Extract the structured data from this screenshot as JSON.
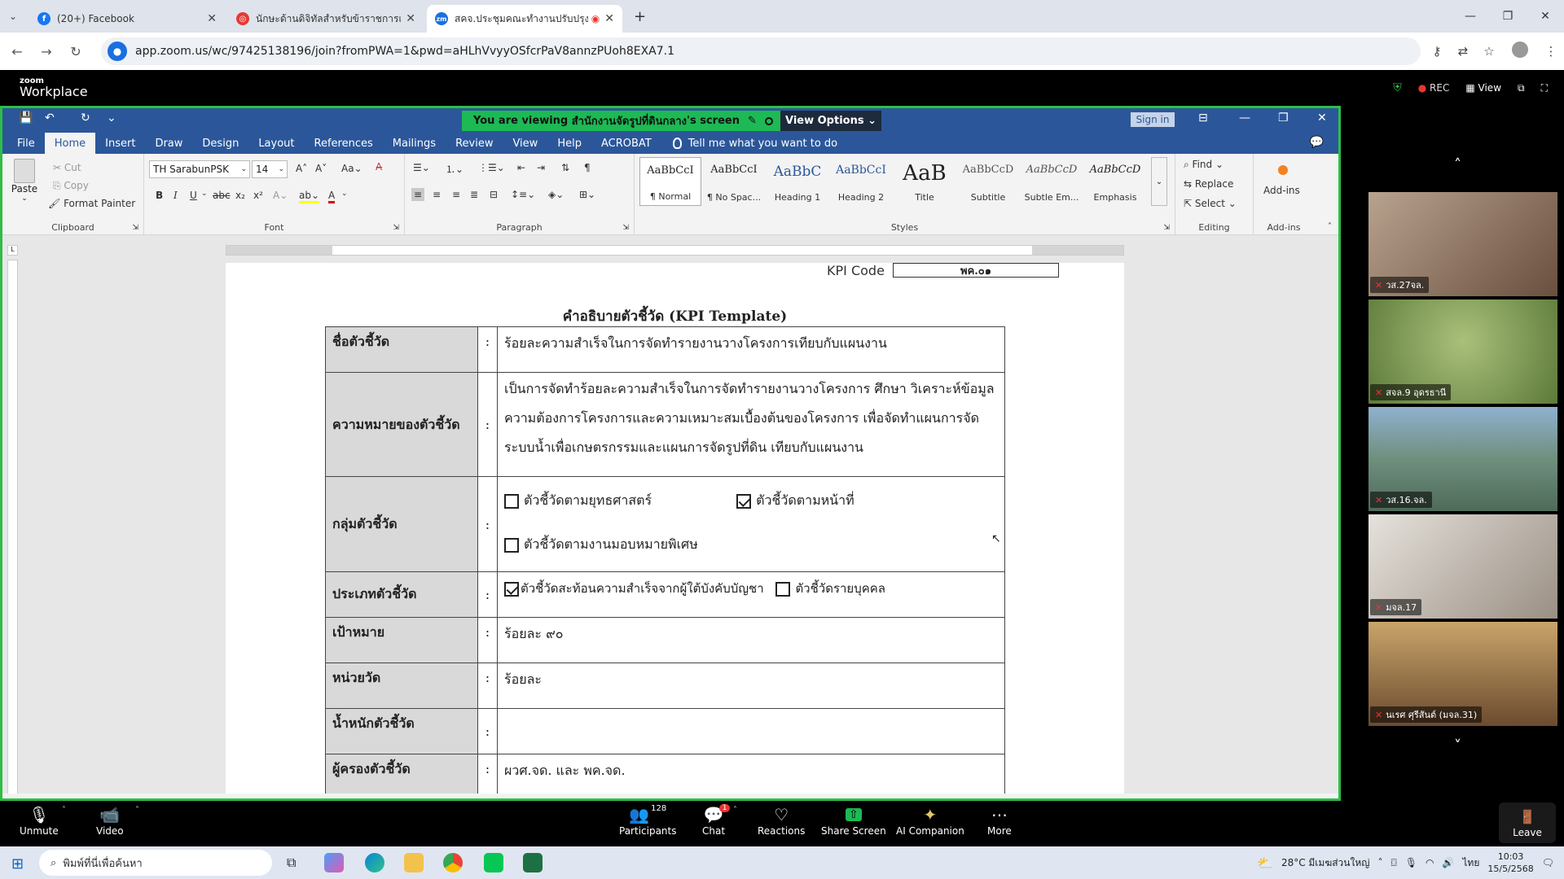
{
  "browser": {
    "tabs": [
      {
        "title": "(20+) Facebook",
        "color": "#1877f2",
        "glyph": "f"
      },
      {
        "title": "นักษะด้านดิจิทัลสำหรับข้าราชการและ",
        "color": "#e53935",
        "glyph": "◎"
      },
      {
        "title": "สคจ.ประชุมคณะทำงานปรับปรุงตั",
        "color": "#1a6fe0",
        "glyph": "zm"
      }
    ],
    "url": "app.zoom.us/wc/97425138196/join?fromPWA=1&pwd=aHLhVvyyOSfcrPaV8annzPUoh8EXA7.1"
  },
  "zoom": {
    "brand_small": "zoom",
    "brand": "Workplace",
    "rec_label": "REC",
    "view_label": "View",
    "banner_prefix": "You are viewing ",
    "banner_name": "สำนักงานจัดรูปที่ดินกลาง",
    "banner_suffix": "'s screen",
    "view_options": "View Options",
    "participants": [
      {
        "name": "วส.27จล.",
        "bg": "#8a7060"
      },
      {
        "name": "สจล.9 อุดรธานี",
        "bg": "#7e9a5a"
      },
      {
        "name": "วส.16.จล.",
        "bg": "#6b8a9c"
      },
      {
        "name": "มจล.17",
        "bg": "#c9c4bd"
      },
      {
        "name": "นเรศ ศุรีสันต์ (มจล.31)",
        "bg": "#9c7a55"
      }
    ],
    "controls": {
      "unmute": "Unmute",
      "video": "Video",
      "participants": "Participants",
      "participants_count": "128",
      "chat": "Chat",
      "chat_badge": "1",
      "reactions": "Reactions",
      "share": "Share Screen",
      "ai": "AI Companion",
      "more": "More",
      "leave": "Leave"
    }
  },
  "word": {
    "sign_in": "Sign in",
    "menu": [
      "File",
      "Home",
      "Insert",
      "Draw",
      "Design",
      "Layout",
      "References",
      "Mailings",
      "Review",
      "View",
      "Help",
      "ACROBAT"
    ],
    "tell_me": "Tell me what you want to do",
    "clipboard": {
      "paste": "Paste",
      "cut": "Cut",
      "copy": "Copy",
      "format_painter": "Format Painter",
      "label": "Clipboard"
    },
    "font": {
      "name": "TH SarabunPSK",
      "size": "14",
      "label": "Font"
    },
    "paragraph_label": "Paragraph",
    "styles_label": "Styles",
    "styles": [
      {
        "preview": "AaBbCcI",
        "name": "¶ Normal"
      },
      {
        "preview": "AaBbCcI",
        "name": "¶ No Spac..."
      },
      {
        "preview": "AaBbC",
        "name": "Heading 1"
      },
      {
        "preview": "AaBbCcI",
        "name": "Heading 2"
      },
      {
        "preview": "AaB",
        "name": "Title"
      },
      {
        "preview": "AaBbCcD",
        "name": "Subtitle"
      },
      {
        "preview": "AaBbCcD",
        "name": "Subtle Em..."
      },
      {
        "preview": "AaBbCcD",
        "name": "Emphasis"
      }
    ],
    "editing": {
      "find": "Find",
      "replace": "Replace",
      "select": "Select",
      "label": "Editing"
    },
    "addins": {
      "name": "Add-ins",
      "label": "Add-ins"
    }
  },
  "document": {
    "kpi_code_label": "KPI Code",
    "kpi_code_value": "พค.๐๑",
    "title": "คำอธิบายตัวชี้วัด (KPI Template)",
    "colon": ":",
    "rows": {
      "name": {
        "label": "ชื่อตัวชี้วัด",
        "value": "ร้อยละความสำเร็จในการจัดทำรายงานวางโครงการเทียบกับแผนงาน"
      },
      "meaning": {
        "label": "ความหมายของตัวชี้วัด",
        "value": "เป็นการจัดทำร้อยละความสำเร็จในการจัดทำรายงานวางโครงการ ศึกษา วิเคราะห์ข้อมูลความต้องการโครงการและความเหมาะสมเบื้องต้นของโครงการ เพื่อจัดทำแผนการจัดระบบน้ำเพื่อเกษตรกรรมและแผนการจัดรูปที่ดิน เทียบกับแผนงาน"
      },
      "group": {
        "label": "กลุ่มตัวชี้วัด",
        "opt1": "ตัวชี้วัดตามยุทธศาสตร์",
        "opt2": "ตัวชี้วัดตามหน้าที่",
        "opt3": "ตัวชี้วัดตามงานมอบหมายพิเศษ"
      },
      "type": {
        "label": "ประเภทตัวชี้วัด",
        "opt1": "ตัวชี้วัดสะท้อนความสำเร็จจากผู้ใต้บังคับบัญชา",
        "opt2": "ตัวชี้วัดรายบุคคล"
      },
      "target": {
        "label": "เป้าหมาย",
        "value": "ร้อยละ ๙๐"
      },
      "unit": {
        "label": "หน่วยวัด",
        "value": "ร้อยละ"
      },
      "weight": {
        "label": "น้ำหนักตัวชี้วัด",
        "value": ""
      },
      "owner": {
        "label": "ผู้ครองตัวชี้วัด",
        "value": "ผวศ.จด. และ พค.จด."
      }
    }
  },
  "taskbar": {
    "search_placeholder": "พิมพ์ที่นี่เพื่อค้นหา",
    "weather": "28°C มีเมฆส่วนใหญ่",
    "lang": "ไทย",
    "time": "10:03",
    "date": "15/5/2568"
  }
}
